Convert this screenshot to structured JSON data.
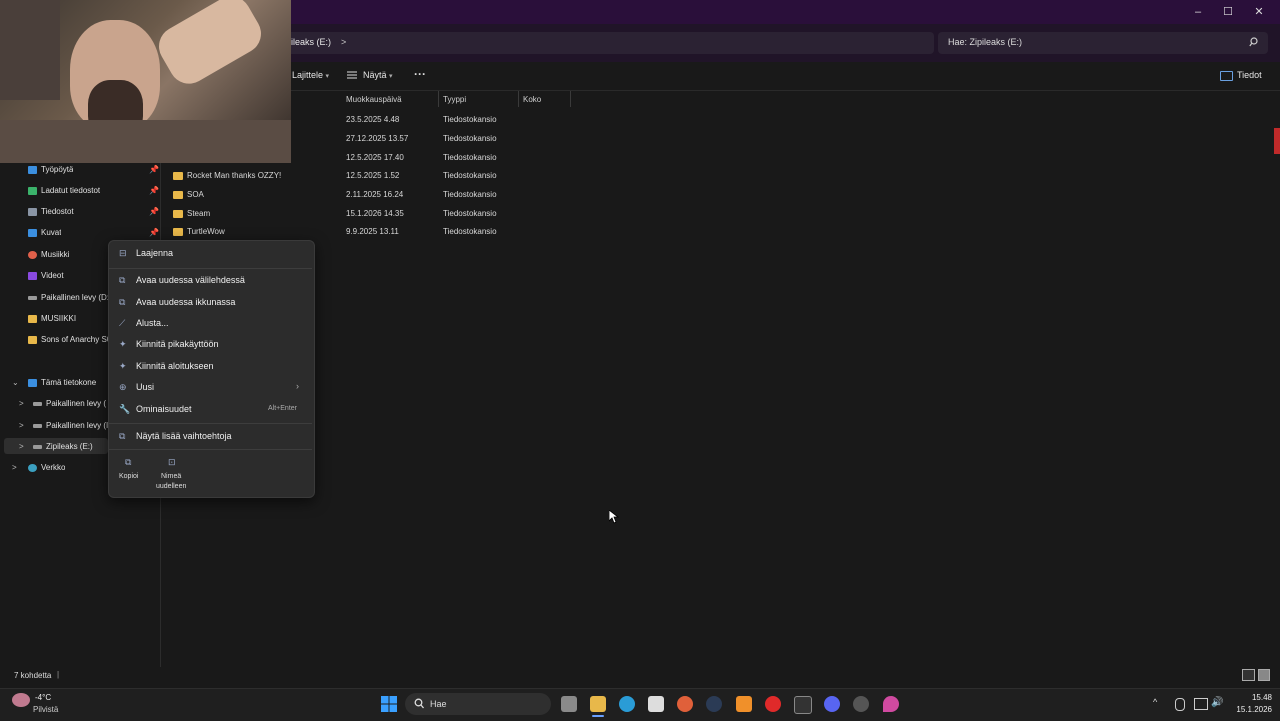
{
  "address": {
    "crumb": "ileaks (E:)",
    "crumb_chevron": ">",
    "search_placeholder": "Hae: Zipileaks (E:)"
  },
  "window_controls": {
    "minimize": "–",
    "maximize": "☐",
    "close": "✕"
  },
  "toolbar": {
    "sort": "Lajittele",
    "view": "Näytä",
    "more": "···",
    "details": "Tiedot"
  },
  "columns": {
    "modified": "Muokkauspäivä",
    "type": "Tyyppi",
    "size": "Koko"
  },
  "rows": [
    {
      "name": "",
      "modified": "23.5.2025 4.48",
      "type": "Tiedostokansio"
    },
    {
      "name": "",
      "modified": "27.12.2025 13.57",
      "type": "Tiedostokansio"
    },
    {
      "name": "",
      "modified": "12.5.2025 17.40",
      "type": "Tiedostokansio"
    },
    {
      "name": "Rocket Man thanks OZZY!",
      "modified": "12.5.2025 1.52",
      "type": "Tiedostokansio"
    },
    {
      "name": "SOA",
      "modified": "2.11.2025 16.24",
      "type": "Tiedostokansio"
    },
    {
      "name": "Steam",
      "modified": "15.1.2026 14.35",
      "type": "Tiedostokansio"
    },
    {
      "name": "TurtleWow",
      "modified": "9.9.2025 13.11",
      "type": "Tiedostokansio"
    }
  ],
  "nav": [
    {
      "label": "Työpöytä",
      "color": "#3b8fe0"
    },
    {
      "label": "Ladatut tiedostot",
      "color": "#3bb36b"
    },
    {
      "label": "Tiedostot",
      "color": "#8a95a5"
    },
    {
      "label": "Kuvat",
      "color": "#3b8fe0"
    },
    {
      "label": "Musiikki",
      "color": "#e0604a"
    },
    {
      "label": "Videot",
      "color": "#8a4ae0"
    },
    {
      "label": "Paikallinen levy (D:",
      "color": "#9a9a9a"
    },
    {
      "label": "MUSIIKKI",
      "color": "#e8b84a"
    },
    {
      "label": "Sons of Anarchy S0",
      "color": "#e8b84a"
    }
  ],
  "tree": [
    {
      "label": "Tämä tietokone",
      "chev": "⌄"
    },
    {
      "label": "Paikallinen levy (",
      "chev": ">"
    },
    {
      "label": "Paikallinen levy (I",
      "chev": ">"
    },
    {
      "label": "Zipileaks (E:)",
      "chev": ">"
    },
    {
      "label": "Verkko",
      "chev": ">"
    }
  ],
  "context_menu": {
    "expand": "Laajenna",
    "open_tab": "Avaa uudessa välilehdessä",
    "open_window": "Avaa uudessa ikkunassa",
    "format": "Alusta...",
    "pin_quick": "Kiinnitä pikakäyttöön",
    "pin_start": "Kiinnitä aloitukseen",
    "new": "Uusi",
    "new_arrow": "›",
    "properties": "Ominaisuudet",
    "properties_shortcut": "Alt+Enter",
    "more": "Näytä lisää vaihtoehtoja",
    "copy": "Kopioi",
    "rename_1": "Nimeä",
    "rename_2": "uudelleen"
  },
  "status": {
    "items": "7 kohdetta",
    "cursor": "|"
  },
  "taskbar": {
    "temp": "-4°C",
    "weather": "Pilvistä",
    "search": "Hae",
    "time": "15.48",
    "date": "15.1.2026",
    "chevron": "^"
  }
}
